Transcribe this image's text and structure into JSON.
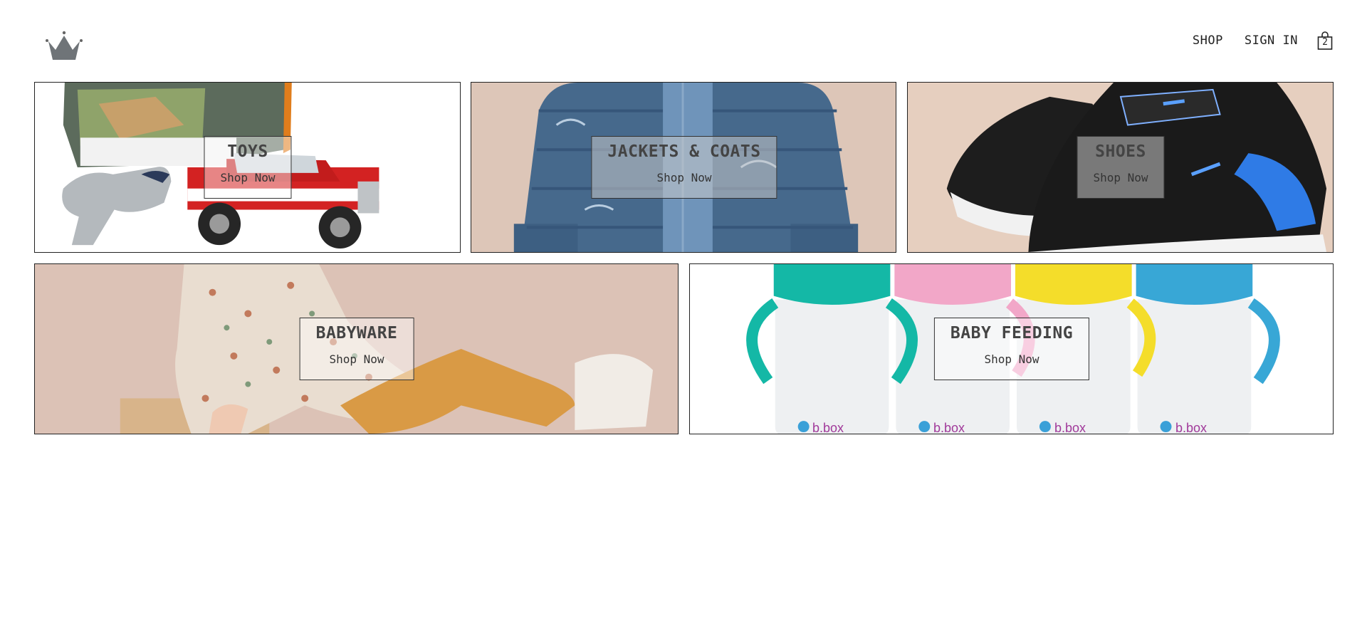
{
  "header": {
    "logo_icon": "crown-icon",
    "nav": {
      "shop": "SHOP",
      "sign_in": "SIGN IN"
    },
    "cart": {
      "icon": "shopping-bag-icon",
      "count": "2"
    }
  },
  "categories": [
    {
      "title": "TOYS",
      "cta": "Shop Now",
      "icon": "toy-truck-image"
    },
    {
      "title": "JACKETS & COATS",
      "cta": "Shop Now",
      "icon": "jacket-image"
    },
    {
      "title": "SHOES",
      "cta": "Shop Now",
      "icon": "sneakers-image"
    },
    {
      "title": "BABYWARE",
      "cta": "Shop Now",
      "icon": "baby-dress-image"
    },
    {
      "title": "BABY FEEDING",
      "cta": "Shop Now",
      "icon": "sippy-cups-image",
      "brand_mark": "b.box"
    }
  ],
  "colors": {
    "border": "#222222",
    "text": "#222222",
    "tile_bg_warm": "#e8d3c6",
    "cup_teal": "#14b8a6",
    "cup_pink": "#f2a7c8",
    "cup_yellow": "#f4dd2a",
    "cup_blue": "#38a7d6"
  }
}
